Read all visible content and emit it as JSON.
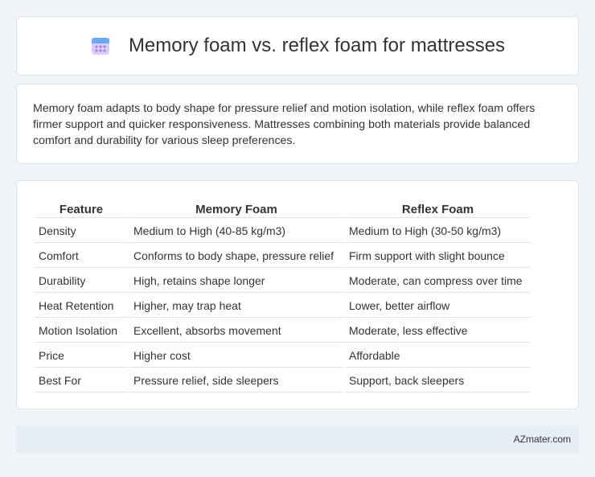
{
  "header": {
    "title": "Memory foam vs. reflex foam for mattresses",
    "icon": "calendar-icon"
  },
  "summary": {
    "text": "Memory foam adapts to body shape for pressure relief and motion isolation, while reflex foam offers firmer support and quicker responsiveness. Mattresses combining both materials provide balanced comfort and durability for various sleep preferences."
  },
  "table": {
    "headers": [
      "Feature",
      "Memory Foam",
      "Reflex Foam"
    ],
    "rows": [
      [
        "Density",
        "Medium to High (40-85 kg/m3)",
        "Medium to High (30-50 kg/m3)"
      ],
      [
        "Comfort",
        "Conforms to body shape, pressure relief",
        "Firm support with slight bounce"
      ],
      [
        "Durability",
        "High, retains shape longer",
        "Moderate, can compress over time"
      ],
      [
        "Heat Retention",
        "Higher, may trap heat",
        "Lower, better airflow"
      ],
      [
        "Motion Isolation",
        "Excellent, absorbs movement",
        "Moderate, less effective"
      ],
      [
        "Price",
        "Higher cost",
        "Affordable"
      ],
      [
        "Best For",
        "Pressure relief, side sleepers",
        "Support, back sleepers"
      ]
    ]
  },
  "footer": {
    "text": "AZmater.com"
  },
  "colors": {
    "background": "#f1f4f9",
    "card": "#ffffff",
    "footer": "#e6edf7",
    "icon_top": "#6aa8f0",
    "icon_body": "#c9b6f2"
  }
}
